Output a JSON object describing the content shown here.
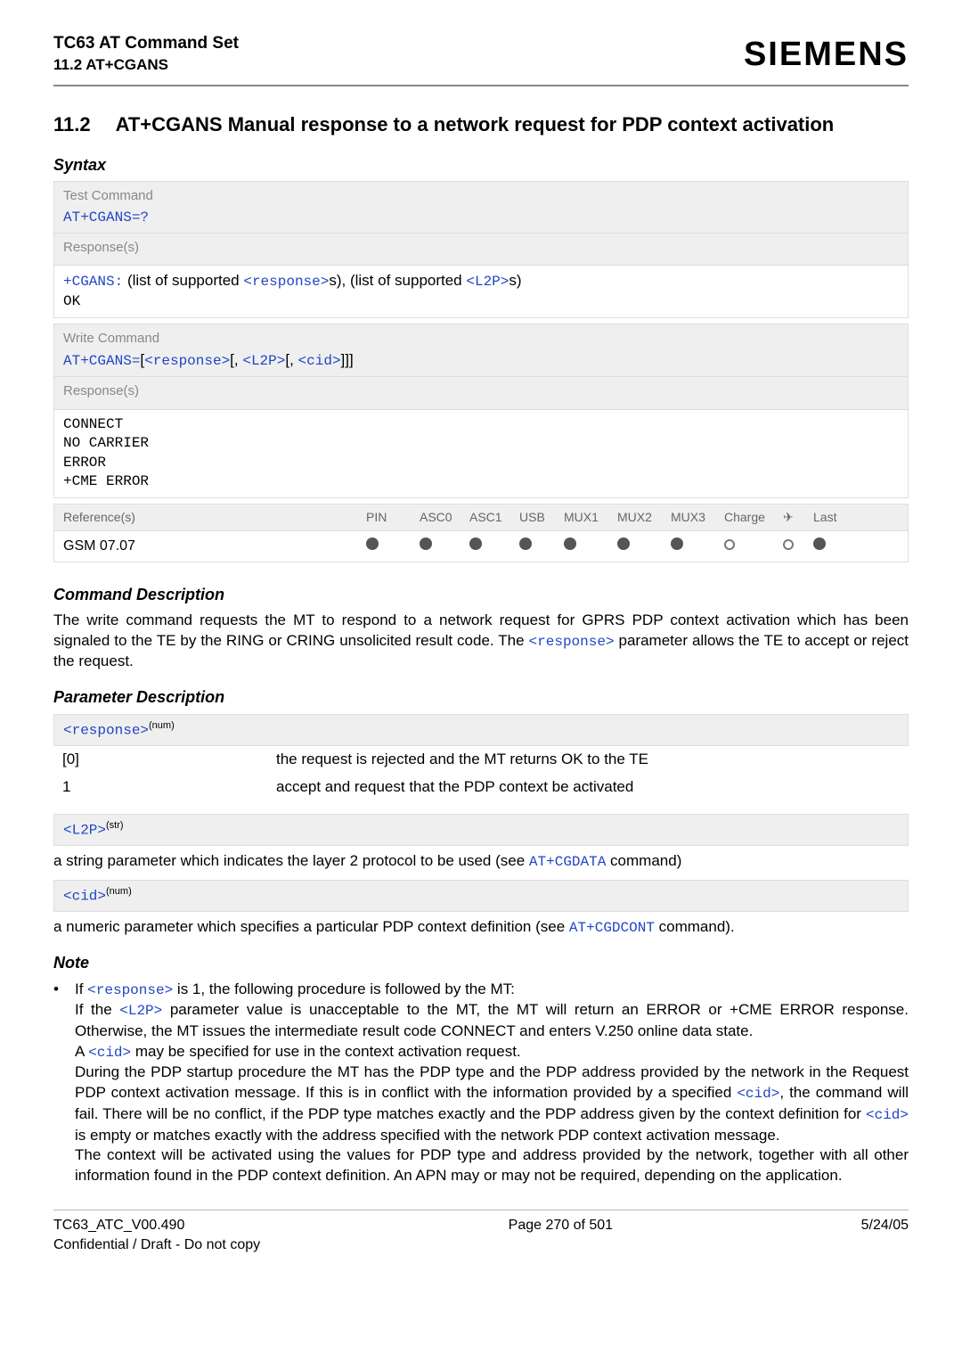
{
  "header": {
    "doc_title": "TC63 AT Command Set",
    "doc_section": "11.2 AT+CGANS",
    "brand": "SIEMENS"
  },
  "section": {
    "number": "11.2",
    "title": "AT+CGANS   Manual response to a network request for PDP context activation"
  },
  "syntax": {
    "heading": "Syntax",
    "test_label": "Test Command",
    "test_cmd": "AT+CGANS=?",
    "test_resp_label": "Response(s)",
    "test_resp_prefix": "+CGANS:",
    "test_resp_mid1": " (list of supported ",
    "test_resp_p1": "<response>",
    "test_resp_mid2": "s), (list of supported ",
    "test_resp_p2": "<L2P>",
    "test_resp_mid3": "s)",
    "test_ok": "OK",
    "write_label": "Write Command",
    "write_cmd_prefix": "AT+CGANS=",
    "write_cmd_b1": "[",
    "write_cmd_p1": "<response>",
    "write_cmd_b2": "[, ",
    "write_cmd_p2": "<L2P>",
    "write_cmd_b3": "[, ",
    "write_cmd_p3": "<cid>",
    "write_cmd_b4": "]]]",
    "write_resp_label": "Response(s)",
    "write_r1": "CONNECT",
    "write_r2": "NO CARRIER",
    "write_r3": "ERROR",
    "write_r4": "+CME ERROR",
    "ref_label": "Reference(s)",
    "ref_h": {
      "pin": "PIN",
      "a0": "ASC0",
      "a1": "ASC1",
      "usb": "USB",
      "m1": "MUX1",
      "m2": "MUX2",
      "m3": "MUX3",
      "ch": "Charge",
      "pl": "✈",
      "last": "Last"
    },
    "ref_val": "GSM 07.07"
  },
  "cmddesc": {
    "heading": "Command Description",
    "p_a": "The write command requests the MT to respond to a network request for GPRS PDP context activation which has been signaled to the TE by the RING or CRING unsolicited result code. The ",
    "p_b": "<response>",
    "p_c": " parameter allows the TE to accept or reject the request."
  },
  "paramdesc": {
    "heading": "Parameter Description",
    "resp_head": "<response>",
    "resp_sup": "(num)",
    "resp_r1k": "[0]",
    "resp_r1v": "the request is rejected and the MT returns OK to the TE",
    "resp_r2k": "1",
    "resp_r2v": "accept and request that the PDP context be activated",
    "l2p_head": "<L2P>",
    "l2p_sup": "(str)",
    "l2p_text_a": "a string parameter which indicates the layer 2 protocol to be used (see ",
    "l2p_text_b": "AT+CGDATA",
    "l2p_text_c": " command)",
    "cid_head": "<cid>",
    "cid_sup": "(num)",
    "cid_text_a": "a numeric parameter which specifies a particular PDP context definition (see ",
    "cid_text_b": "AT+CGDCONT",
    "cid_text_c": " command)."
  },
  "note": {
    "heading": "Note",
    "bullet": "•",
    "l1a": "If ",
    "l1b": "<response>",
    "l1c": " is 1, the following procedure is followed by the MT:",
    "l2a": "If the ",
    "l2b": "<L2P>",
    "l2c": " parameter value is unacceptable to the MT, the MT will return an ERROR or +CME ERROR response. Otherwise, the MT issues the intermediate result code CONNECT and enters V.250 online data state.",
    "l3a": "A ",
    "l3b": "<cid>",
    "l3c": " may be specified for use in the context activation request.",
    "l4a": "During the PDP startup procedure the MT has the PDP type and the PDP address provided by the network in the Request PDP context activation message. If this is in conflict with the information provided by a specified ",
    "l4b": "<cid>",
    "l4c": ", the command will fail. There will be no conflict, if the PDP type matches exactly and the PDP address given by the context definition for ",
    "l4d": "<cid>",
    "l4e": " is empty or matches exactly with the address specified with the network PDP context activation message.",
    "l5": "The context will be activated using the values for PDP type and address provided by the network, together with all other information found in the PDP context definition. An APN may or may not be required, depending on the application."
  },
  "footer": {
    "left1": "TC63_ATC_V00.490",
    "left2": "Confidential / Draft - Do not copy",
    "center": "Page 270 of 501",
    "right": "5/24/05"
  }
}
